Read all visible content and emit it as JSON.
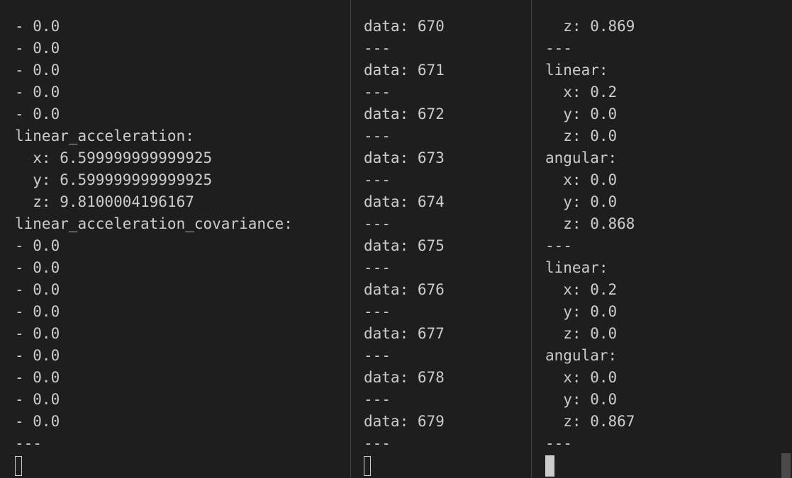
{
  "panes": {
    "left": {
      "lines": [
        "- 0.0",
        "- 0.0",
        "- 0.0",
        "- 0.0",
        "- 0.0",
        "linear_acceleration:",
        "  x: 6.599999999999925",
        "  y: 6.599999999999925",
        "  z: 9.8100004196167",
        "linear_acceleration_covariance:",
        "- 0.0",
        "- 0.0",
        "- 0.0",
        "- 0.0",
        "- 0.0",
        "- 0.0",
        "- 0.0",
        "- 0.0",
        "- 0.0",
        "---"
      ],
      "cursor_style": "outline"
    },
    "middle": {
      "lines": [
        "data: 670",
        "---",
        "data: 671",
        "---",
        "data: 672",
        "---",
        "data: 673",
        "---",
        "data: 674",
        "---",
        "data: 675",
        "---",
        "data: 676",
        "---",
        "data: 677",
        "---",
        "data: 678",
        "---",
        "data: 679",
        "---"
      ],
      "cursor_style": "outline"
    },
    "right": {
      "lines": [
        "  z: 0.869",
        "---",
        "linear:",
        "  x: 0.2",
        "  y: 0.0",
        "  z: 0.0",
        "angular:",
        "  x: 0.0",
        "  y: 0.0",
        "  z: 0.868",
        "---",
        "linear:",
        "  x: 0.2",
        "  y: 0.0",
        "  z: 0.0",
        "angular:",
        "  x: 0.0",
        "  y: 0.0",
        "  z: 0.867",
        "---"
      ],
      "cursor_style": "block"
    }
  },
  "colors": {
    "background": "#1e1e1e",
    "text": "#cccccc",
    "divider": "#444444"
  }
}
